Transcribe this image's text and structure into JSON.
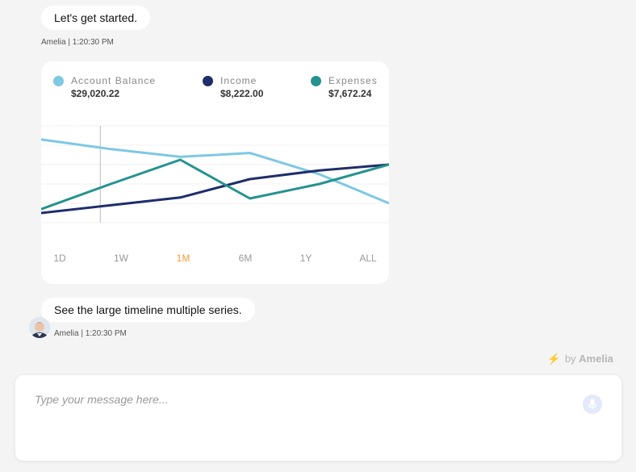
{
  "messages": [
    {
      "text": "Let's get started.",
      "meta": "Amelia | 1:20:30 PM"
    },
    {
      "text": "See the large timeline multiple series.",
      "meta": "Amelia | 1:20:30 PM"
    }
  ],
  "legend": [
    {
      "label": "Account Balance",
      "value": "$29,020.22",
      "color": "#7ec8e3"
    },
    {
      "label": "Income",
      "value": "$8,222.00",
      "color": "#1f2d6b"
    },
    {
      "label": "Expenses",
      "value": "$7,672.24",
      "color": "#24938f"
    }
  ],
  "ranges": [
    {
      "label": "1D",
      "active": false
    },
    {
      "label": "1W",
      "active": false
    },
    {
      "label": "1M",
      "active": true
    },
    {
      "label": "6M",
      "active": false
    },
    {
      "label": "1Y",
      "active": false
    },
    {
      "label": "ALL",
      "active": false
    }
  ],
  "chart_data": {
    "type": "line",
    "x": [
      0,
      1,
      2,
      3,
      4,
      5
    ],
    "ylim": [
      0,
      100
    ],
    "grid": true,
    "series": [
      {
        "name": "Account Balance",
        "color": "#7ec8e3",
        "values": [
          86,
          76,
          68,
          72,
          50,
          20
        ]
      },
      {
        "name": "Income",
        "color": "#1f2d6b",
        "values": [
          10,
          18,
          26,
          45,
          54,
          60
        ]
      },
      {
        "name": "Expenses",
        "color": "#24938f",
        "values": [
          14,
          40,
          65,
          25,
          40,
          60
        ]
      }
    ],
    "cursor_x": 0.85
  },
  "brand": {
    "prefix": "by",
    "name": "Amelia"
  },
  "composer": {
    "placeholder": "Type your message here..."
  }
}
